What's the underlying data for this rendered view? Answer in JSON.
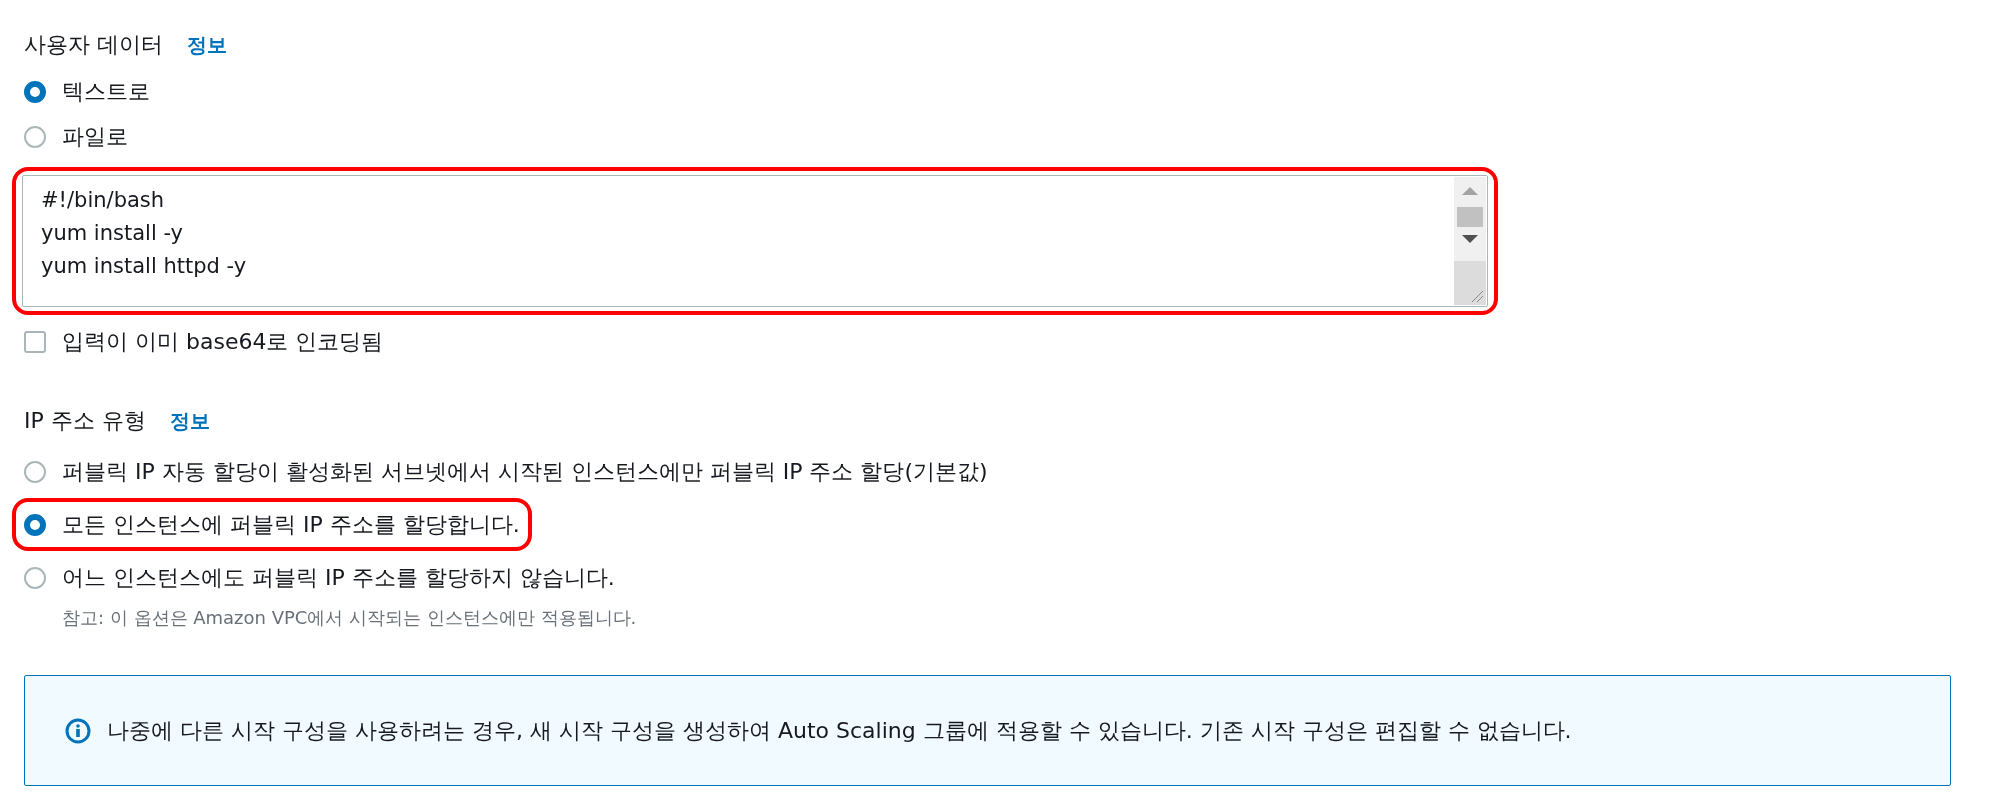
{
  "user_data": {
    "label": "사용자 데이터",
    "info_link": "정보",
    "options": [
      {
        "label": "텍스트로",
        "selected": true
      },
      {
        "label": "파일로",
        "selected": false
      }
    ],
    "script": {
      "lines": [
        "#!/bin/bash",
        "yum install -y",
        "yum install httpd -y"
      ],
      "highlighted": true
    },
    "base64_checkbox": {
      "label": "입력이 이미 base64로 인코딩됨",
      "checked": false
    }
  },
  "ip_address_type": {
    "label": "IP 주소 유형",
    "info_link": "정보",
    "options": [
      {
        "label": "퍼블릭 IP 자동 할당이 활성화된 서브넷에서 시작된 인스턴스에만 퍼블릭 IP 주소 할당(기본값)",
        "selected": false,
        "highlighted": false
      },
      {
        "label": "모든 인스턴스에 퍼블릭 IP 주소를 할당합니다.",
        "selected": true,
        "highlighted": true
      },
      {
        "label": "어느 인스턴스에도 퍼블릭 IP 주소를 할당하지 않습니다.",
        "selected": false,
        "highlighted": false,
        "note": "참고: 이 옵션은 Amazon VPC에서 시작되는 인스턴스에만 적용됩니다."
      }
    ]
  },
  "info_alert": {
    "text": "나중에 다른 시작 구성을 사용하려는 경우, 새 시작 구성을 생성하여 Auto Scaling 그룹에 적용할 수 있습니다. 기존 시작 구성은 편집할 수 없습니다."
  }
}
